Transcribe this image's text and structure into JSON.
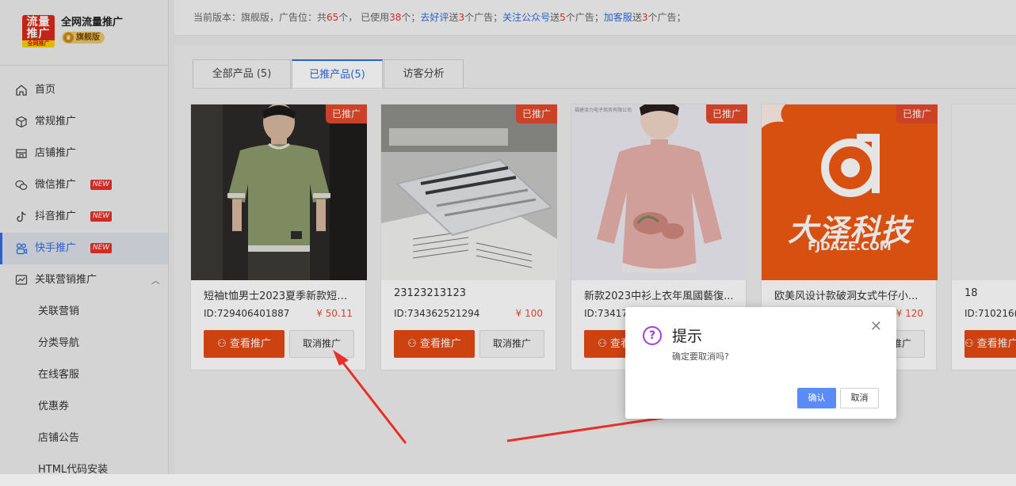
{
  "brand": {
    "logo_line1": "流量",
    "logo_line2": "推广",
    "logo_line3": "全网推广",
    "title": "全网流量推广",
    "edition": "旗舰版"
  },
  "menu": [
    {
      "label": "首页",
      "icon": "home-icon"
    },
    {
      "label": "常规推广",
      "icon": "cube-icon"
    },
    {
      "label": "店铺推广",
      "icon": "store-icon"
    },
    {
      "label": "微信推广",
      "icon": "wechat-icon",
      "badge": "NEW"
    },
    {
      "label": "抖音推广",
      "icon": "tiktok-icon",
      "badge": "NEW"
    },
    {
      "label": "快手推广",
      "icon": "kuaishou-icon",
      "badge": "NEW",
      "active": true
    },
    {
      "label": "关联营销推广",
      "icon": "chart-icon",
      "expanded": true
    }
  ],
  "submenu": [
    "关联营销",
    "分类导航",
    "在线客服",
    "优惠券",
    "店铺公告",
    "HTML代码安装"
  ],
  "notice": {
    "prefix": "当前版本：旗舰版，广告位：共",
    "total": "65",
    "mid1": "个，  已使用",
    "used": "38",
    "mid2": "个；",
    "link1": "去好评",
    "mid3": "送",
    "n1": "3",
    "mid4": "个广告；",
    "link2": "关注公众号",
    "mid5": "送",
    "n2": "5",
    "mid6": "个广告；",
    "link3": "加客服",
    "mid7": "送",
    "n3": "3",
    "mid8": "个广告；"
  },
  "tabs": [
    {
      "label": "全部产品 (5)"
    },
    {
      "label": "已推产品(5)",
      "active": true
    },
    {
      "label": "访客分析"
    }
  ],
  "product_tag": "已推广",
  "view_button": "查看推广",
  "cancel_button": "取消推广",
  "products": [
    {
      "title": "短袖t恤男士2023夏季新款短袖...",
      "id": "ID:729406401887",
      "price": "¥ 50.11",
      "image": "green-tshirt-photo"
    },
    {
      "title": "23123213123",
      "id": "ID:734362521294",
      "price": "¥ 100",
      "image": "pencil-case-photo"
    },
    {
      "title": "新款2023中衫上衣年風國藝復...",
      "id": "ID:73417",
      "price": "",
      "image": "pink-blouse-photo",
      "image_caption": "福建泽力电子商务有限公司"
    },
    {
      "title": "欧美风设计款破洞女式牛仔小...",
      "id": "",
      "price": "¥ 120",
      "image": "fjdaze-logo-image",
      "logo_cn": "大泽科技",
      "logo_en": "FJDAZE.COM"
    },
    {
      "title": "18",
      "id": "ID:710216(",
      "price": "",
      "image": "blank-photo"
    }
  ],
  "dialog": {
    "title": "提示",
    "message": "确定要取消吗?",
    "ok": "确认",
    "cancel": "取消"
  },
  "colors": {
    "accent": "#2f6de0",
    "orange_button": "#e44a14",
    "tag_red": "#e24a2b",
    "arrow_red": "#e8302a"
  }
}
